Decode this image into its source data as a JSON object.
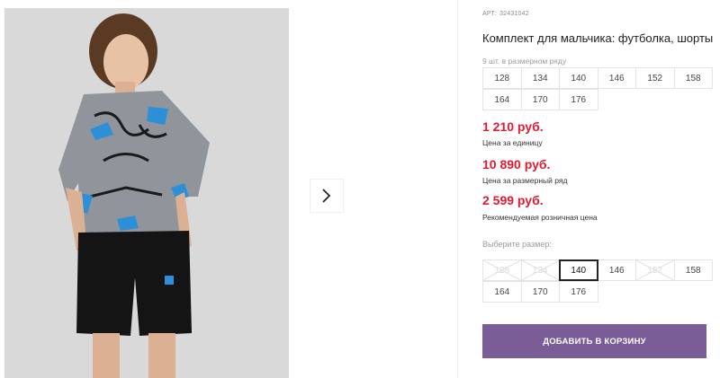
{
  "gallery": {
    "next_icon": "chevron-right-icon"
  },
  "product": {
    "article_label": "АРТ:",
    "article": "32431042",
    "title": "Комплект для мальчика: футболка, шорты",
    "size_row_note": "9 шт. в размерном ряду",
    "size_row": [
      "128",
      "134",
      "140",
      "146",
      "152",
      "158",
      "164",
      "170",
      "176"
    ],
    "unit_price": "1 210 руб.",
    "unit_price_caption": "Цена за единицу",
    "row_price": "10 890 руб.",
    "row_price_caption": "Цена за размерный ряд",
    "rrp_price": "2 599 руб.",
    "rrp_caption": "Рекомендуемая розничная цена",
    "price_color": "#e11931"
  },
  "size_select": {
    "label": "Выберите размер:",
    "options": [
      {
        "size": "128",
        "state": "disabled"
      },
      {
        "size": "134",
        "state": "disabled"
      },
      {
        "size": "140",
        "state": "selected"
      },
      {
        "size": "146",
        "state": "available"
      },
      {
        "size": "152",
        "state": "disabled"
      },
      {
        "size": "158",
        "state": "available"
      },
      {
        "size": "164",
        "state": "available"
      },
      {
        "size": "170",
        "state": "available"
      },
      {
        "size": "176",
        "state": "available"
      }
    ]
  },
  "cart": {
    "add_label": "ДОБАВИТЬ В КОРЗИНУ",
    "button_color": "#7a5c97"
  }
}
